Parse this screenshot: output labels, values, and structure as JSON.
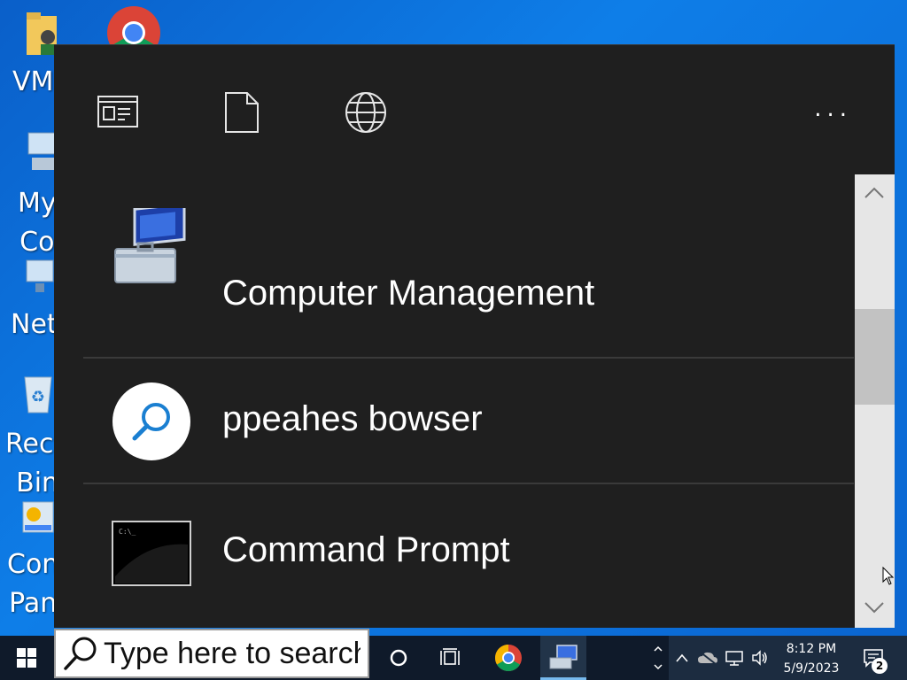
{
  "desktop": {
    "icons": [
      {
        "label": "VM"
      },
      {
        "label": "My\nCo"
      },
      {
        "label": "Net"
      },
      {
        "label": "Recy\nBin"
      },
      {
        "label": "Con\nPan"
      }
    ]
  },
  "panel": {
    "toolbar": {
      "apps_icon": "apps-icon",
      "documents_icon": "document-icon",
      "web_icon": "globe-icon",
      "more_label": "..."
    },
    "results": [
      {
        "label": "Computer Management",
        "icon": "computer-management-icon"
      },
      {
        "label": "ppeahes bowser",
        "icon": "web-search-icon"
      },
      {
        "label": "Command Prompt",
        "icon": "command-prompt-icon"
      }
    ]
  },
  "taskbar": {
    "search_placeholder": "Type here to search",
    "clock_time": "8:12 PM",
    "clock_date": "5/9/2023",
    "notification_count": "2"
  },
  "colors": {
    "panel_bg": "#1f1f1f",
    "accent": "#0078d7",
    "desktop_bg": "#0a6fd9"
  }
}
